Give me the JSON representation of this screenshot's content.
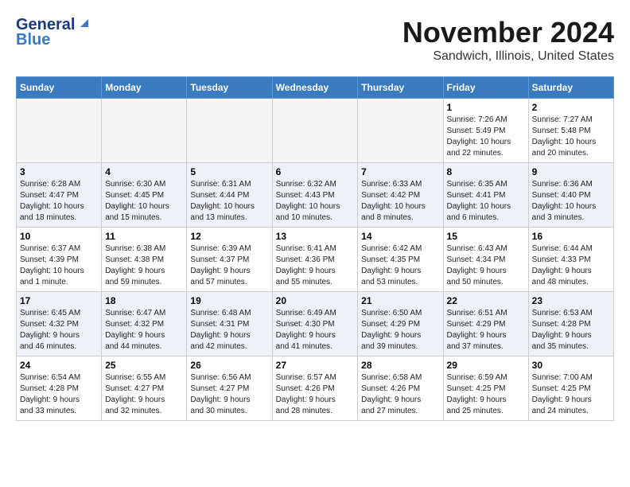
{
  "header": {
    "logo_line1": "General",
    "logo_line2": "Blue",
    "month_title": "November 2024",
    "location": "Sandwich, Illinois, United States"
  },
  "days_of_week": [
    "Sunday",
    "Monday",
    "Tuesday",
    "Wednesday",
    "Thursday",
    "Friday",
    "Saturday"
  ],
  "weeks": [
    [
      {
        "day": "",
        "info": ""
      },
      {
        "day": "",
        "info": ""
      },
      {
        "day": "",
        "info": ""
      },
      {
        "day": "",
        "info": ""
      },
      {
        "day": "",
        "info": ""
      },
      {
        "day": "1",
        "info": "Sunrise: 7:26 AM\nSunset: 5:49 PM\nDaylight: 10 hours\nand 22 minutes."
      },
      {
        "day": "2",
        "info": "Sunrise: 7:27 AM\nSunset: 5:48 PM\nDaylight: 10 hours\nand 20 minutes."
      }
    ],
    [
      {
        "day": "3",
        "info": "Sunrise: 6:28 AM\nSunset: 4:47 PM\nDaylight: 10 hours\nand 18 minutes."
      },
      {
        "day": "4",
        "info": "Sunrise: 6:30 AM\nSunset: 4:45 PM\nDaylight: 10 hours\nand 15 minutes."
      },
      {
        "day": "5",
        "info": "Sunrise: 6:31 AM\nSunset: 4:44 PM\nDaylight: 10 hours\nand 13 minutes."
      },
      {
        "day": "6",
        "info": "Sunrise: 6:32 AM\nSunset: 4:43 PM\nDaylight: 10 hours\nand 10 minutes."
      },
      {
        "day": "7",
        "info": "Sunrise: 6:33 AM\nSunset: 4:42 PM\nDaylight: 10 hours\nand 8 minutes."
      },
      {
        "day": "8",
        "info": "Sunrise: 6:35 AM\nSunset: 4:41 PM\nDaylight: 10 hours\nand 6 minutes."
      },
      {
        "day": "9",
        "info": "Sunrise: 6:36 AM\nSunset: 4:40 PM\nDaylight: 10 hours\nand 3 minutes."
      }
    ],
    [
      {
        "day": "10",
        "info": "Sunrise: 6:37 AM\nSunset: 4:39 PM\nDaylight: 10 hours\nand 1 minute."
      },
      {
        "day": "11",
        "info": "Sunrise: 6:38 AM\nSunset: 4:38 PM\nDaylight: 9 hours\nand 59 minutes."
      },
      {
        "day": "12",
        "info": "Sunrise: 6:39 AM\nSunset: 4:37 PM\nDaylight: 9 hours\nand 57 minutes."
      },
      {
        "day": "13",
        "info": "Sunrise: 6:41 AM\nSunset: 4:36 PM\nDaylight: 9 hours\nand 55 minutes."
      },
      {
        "day": "14",
        "info": "Sunrise: 6:42 AM\nSunset: 4:35 PM\nDaylight: 9 hours\nand 53 minutes."
      },
      {
        "day": "15",
        "info": "Sunrise: 6:43 AM\nSunset: 4:34 PM\nDaylight: 9 hours\nand 50 minutes."
      },
      {
        "day": "16",
        "info": "Sunrise: 6:44 AM\nSunset: 4:33 PM\nDaylight: 9 hours\nand 48 minutes."
      }
    ],
    [
      {
        "day": "17",
        "info": "Sunrise: 6:45 AM\nSunset: 4:32 PM\nDaylight: 9 hours\nand 46 minutes."
      },
      {
        "day": "18",
        "info": "Sunrise: 6:47 AM\nSunset: 4:32 PM\nDaylight: 9 hours\nand 44 minutes."
      },
      {
        "day": "19",
        "info": "Sunrise: 6:48 AM\nSunset: 4:31 PM\nDaylight: 9 hours\nand 42 minutes."
      },
      {
        "day": "20",
        "info": "Sunrise: 6:49 AM\nSunset: 4:30 PM\nDaylight: 9 hours\nand 41 minutes."
      },
      {
        "day": "21",
        "info": "Sunrise: 6:50 AM\nSunset: 4:29 PM\nDaylight: 9 hours\nand 39 minutes."
      },
      {
        "day": "22",
        "info": "Sunrise: 6:51 AM\nSunset: 4:29 PM\nDaylight: 9 hours\nand 37 minutes."
      },
      {
        "day": "23",
        "info": "Sunrise: 6:53 AM\nSunset: 4:28 PM\nDaylight: 9 hours\nand 35 minutes."
      }
    ],
    [
      {
        "day": "24",
        "info": "Sunrise: 6:54 AM\nSunset: 4:28 PM\nDaylight: 9 hours\nand 33 minutes."
      },
      {
        "day": "25",
        "info": "Sunrise: 6:55 AM\nSunset: 4:27 PM\nDaylight: 9 hours\nand 32 minutes."
      },
      {
        "day": "26",
        "info": "Sunrise: 6:56 AM\nSunset: 4:27 PM\nDaylight: 9 hours\nand 30 minutes."
      },
      {
        "day": "27",
        "info": "Sunrise: 6:57 AM\nSunset: 4:26 PM\nDaylight: 9 hours\nand 28 minutes."
      },
      {
        "day": "28",
        "info": "Sunrise: 6:58 AM\nSunset: 4:26 PM\nDaylight: 9 hours\nand 27 minutes."
      },
      {
        "day": "29",
        "info": "Sunrise: 6:59 AM\nSunset: 4:25 PM\nDaylight: 9 hours\nand 25 minutes."
      },
      {
        "day": "30",
        "info": "Sunrise: 7:00 AM\nSunset: 4:25 PM\nDaylight: 9 hours\nand 24 minutes."
      }
    ]
  ]
}
